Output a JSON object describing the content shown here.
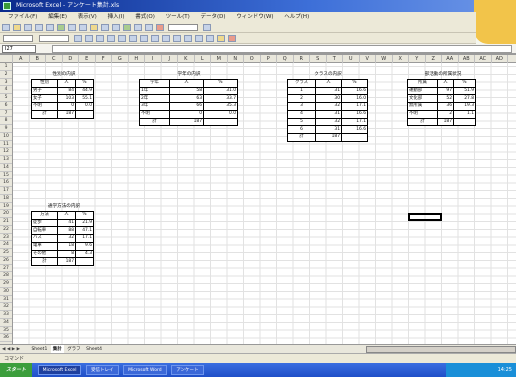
{
  "window": {
    "title": "Microsoft Excel - アンケート集計.xls",
    "buttons": [
      "_",
      "□",
      "×"
    ]
  },
  "menu": [
    "ファイル(F)",
    "編集(E)",
    "表示(V)",
    "挿入(I)",
    "書式(O)",
    "ツール(T)",
    "データ(D)",
    "ウィンドウ(W)",
    "ヘルプ(H)"
  ],
  "namebox": "I27",
  "columns": [
    "A",
    "B",
    "C",
    "D",
    "E",
    "F",
    "G",
    "H",
    "I",
    "J",
    "K",
    "L",
    "M",
    "N",
    "O",
    "P",
    "Q",
    "R",
    "S",
    "T",
    "U",
    "V",
    "W",
    "X",
    "Y",
    "Z",
    "AA",
    "AB",
    "AC",
    "AD"
  ],
  "rows": [
    "1",
    "2",
    "3",
    "4",
    "5",
    "6",
    "7",
    "8",
    "9",
    "10",
    "11",
    "12",
    "13",
    "14",
    "15",
    "16",
    "17",
    "18",
    "19",
    "20",
    "21",
    "22",
    "23",
    "24",
    "25",
    "26",
    "27",
    "28",
    "29",
    "30",
    "31",
    "32",
    "33",
    "34",
    "35",
    "36"
  ],
  "tables": {
    "t1": {
      "title": "性別の内訳",
      "header": [
        "性別",
        "人",
        "%"
      ],
      "rows": [
        [
          "男子",
          "84",
          "44.9"
        ],
        [
          "女子",
          "103",
          "55.1"
        ],
        [
          "不明",
          "0",
          "0.0"
        ]
      ],
      "total": [
        "計",
        "187",
        ""
      ]
    },
    "t2": {
      "title": "学年の内訳",
      "header": [
        "学年",
        "人",
        "%"
      ],
      "rows": [
        [
          "1年",
          "58",
          "31.0"
        ],
        [
          "2年",
          "63",
          "33.7"
        ],
        [
          "3年",
          "66",
          "35.3"
        ],
        [
          "不明",
          "0",
          "0.0"
        ]
      ],
      "total": [
        "計",
        "187",
        ""
      ]
    },
    "t3": {
      "title": "クラスの内訳",
      "header": [
        "クラス",
        "人",
        "%"
      ],
      "rows": [
        [
          "1",
          "31",
          "16.6"
        ],
        [
          "2",
          "30",
          "16.0"
        ],
        [
          "3",
          "32",
          "17.1"
        ],
        [
          "4",
          "31",
          "16.6"
        ],
        [
          "5",
          "32",
          "17.1"
        ],
        [
          "6",
          "31",
          "16.6"
        ]
      ],
      "total": [
        "計",
        "187",
        ""
      ]
    },
    "t4": {
      "title": "部活動の所属状況",
      "header": [
        "所属",
        "人",
        "%"
      ],
      "rows": [
        [
          "運動部",
          "97",
          "51.9"
        ],
        [
          "文化部",
          "52",
          "27.8"
        ],
        [
          "無所属",
          "36",
          "19.3"
        ],
        [
          "不明",
          "2",
          "1.1"
        ]
      ],
      "total": [
        "計",
        "187",
        ""
      ]
    },
    "t5": {
      "title": "通学方法の内訳",
      "header": [
        "方法",
        "人",
        "%"
      ],
      "rows": [
        [
          "徒歩",
          "41",
          "21.9"
        ],
        [
          "自転車",
          "88",
          "47.1"
        ],
        [
          "バス",
          "32",
          "17.1"
        ],
        [
          "電車",
          "18",
          "9.6"
        ],
        [
          "その他",
          "8",
          "4.3"
        ]
      ],
      "total": [
        "計",
        "187",
        ""
      ]
    }
  },
  "sheet_tabs": [
    "Sheet1",
    "集計",
    "グラフ",
    "Sheet4"
  ],
  "active_sheet": "集計",
  "status": "コマンド",
  "taskbar": {
    "start": "スタート",
    "tasks": [
      "Microsoft Excel",
      "受信トレイ",
      "Microsoft Word",
      "アンケート"
    ],
    "clock": "14:25"
  }
}
